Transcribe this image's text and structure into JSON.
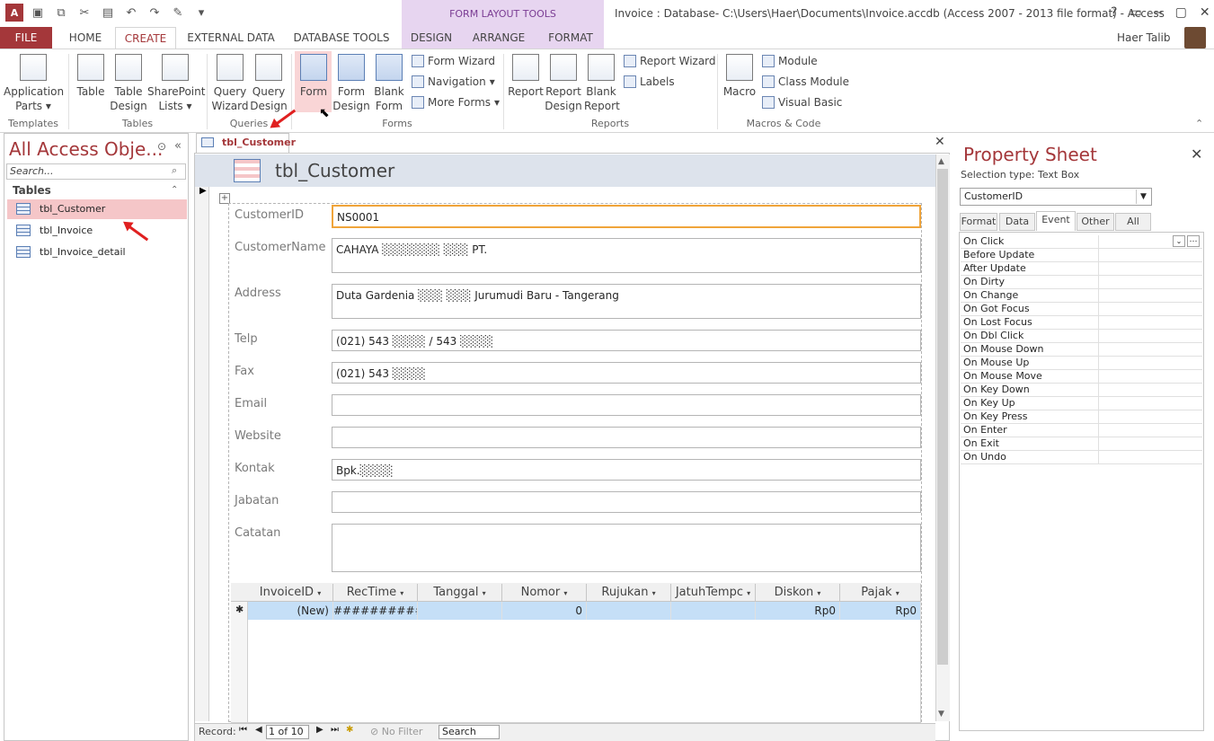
{
  "window": {
    "title": "Invoice : Database- C:\\Users\\Haer\\Documents\\Invoice.accdb (Access 2007 - 2013 file format) - Access",
    "context_tab": "FORM LAYOUT TOOLS",
    "user": "Haer Talib"
  },
  "tabs": [
    "FILE",
    "HOME",
    "CREATE",
    "EXTERNAL DATA",
    "DATABASE TOOLS",
    "DESIGN",
    "ARRANGE",
    "FORMAT"
  ],
  "ribbon": {
    "app_parts": "Application Parts",
    "table": "Table",
    "table_design": "Table Design",
    "sharepoint": "SharePoint Lists",
    "query_wizard": "Query Wizard",
    "query_design": "Query Design",
    "form": "Form",
    "form_design": "Form Design",
    "blank_form": "Blank Form",
    "form_wizard": "Form Wizard",
    "navigation": "Navigation",
    "more_forms": "More Forms",
    "report": "Report",
    "report_design": "Report Design",
    "blank_report": "Blank Report",
    "report_wizard": "Report Wizard",
    "labels": "Labels",
    "macro": "Macro",
    "module": "Module",
    "class_module": "Class Module",
    "visual_basic": "Visual Basic",
    "groups": [
      "Templates",
      "Tables",
      "Queries",
      "Forms",
      "Reports",
      "Macros & Code"
    ]
  },
  "nav": {
    "title": "All Access Obje...",
    "search_placeholder": "Search...",
    "section": "Tables",
    "items": [
      "tbl_Customer",
      "tbl_Invoice",
      "tbl_Invoice_detail"
    ]
  },
  "doc": {
    "tab": "tbl_Customer",
    "form_title": "tbl_Customer"
  },
  "fields": [
    {
      "label": "CustomerID",
      "value": "NS0001"
    },
    {
      "label": "CustomerName",
      "value": "CAHAYA ░░░░░░░ ░░░ PT."
    },
    {
      "label": "Address",
      "value": "Duta Gardenia ░░░ ░░░ Jurumudi Baru - Tangerang"
    },
    {
      "label": "Telp",
      "value": "(021) 543 ░░░░ / 543 ░░░░"
    },
    {
      "label": "Fax",
      "value": "(021) 543 ░░░░"
    },
    {
      "label": "Email",
      "value": ""
    },
    {
      "label": "Website",
      "value": ""
    },
    {
      "label": "Kontak",
      "value": "Bpk.░░░░"
    },
    {
      "label": "Jabatan",
      "value": ""
    },
    {
      "label": "Catatan",
      "value": ""
    }
  ],
  "subform": {
    "columns": [
      "InvoiceID",
      "RecTime",
      "Tanggal",
      "Nomor",
      "Rujukan",
      "JatuhTempc",
      "Diskon",
      "Pajak"
    ],
    "new_row": [
      "(New)",
      "##############",
      "",
      "0",
      "",
      "",
      "Rp0",
      "Rp0"
    ],
    "marker": "✱"
  },
  "record_nav": {
    "label": "Record:",
    "position": "1 of 10",
    "filter": "No Filter",
    "search": "Search"
  },
  "property_sheet": {
    "title": "Property Sheet",
    "selection_type": "Selection type:  Text Box",
    "selected": "CustomerID",
    "tabs": [
      "Format",
      "Data",
      "Event",
      "Other",
      "All"
    ],
    "active_tab": "Event",
    "events": [
      "On Click",
      "Before Update",
      "After Update",
      "On Dirty",
      "On Change",
      "On Got Focus",
      "On Lost Focus",
      "On Dbl Click",
      "On Mouse Down",
      "On Mouse Up",
      "On Mouse Move",
      "On Key Down",
      "On Key Up",
      "On Key Press",
      "On Enter",
      "On Exit",
      "On Undo"
    ]
  },
  "colors": {
    "accent": "#a4373a",
    "context": "#e7d5f0",
    "highlight": "#f5c6c8",
    "selection": "#c5dff7"
  }
}
